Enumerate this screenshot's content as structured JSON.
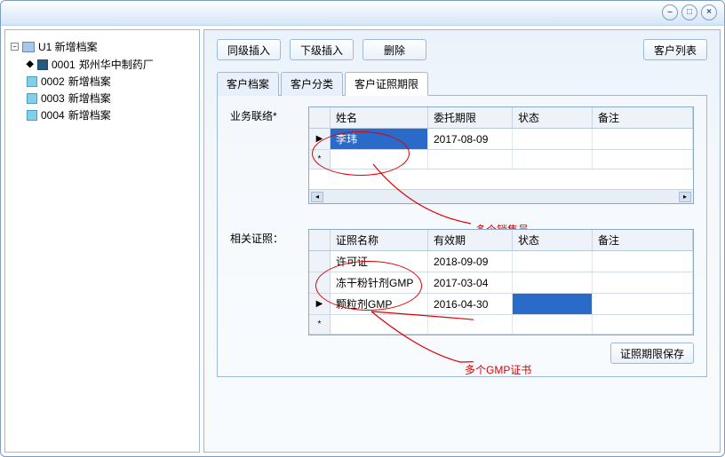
{
  "window": {
    "minimize": "–",
    "maximize": "□",
    "close": "×"
  },
  "tree": {
    "root": "U1 新增档案",
    "items": [
      {
        "code": "0001",
        "label": "郑州华中制药厂",
        "dark": true
      },
      {
        "code": "0002",
        "label": "新增档案",
        "dark": false
      },
      {
        "code": "0003",
        "label": "新增档案",
        "dark": false
      },
      {
        "code": "0004",
        "label": "新增档案",
        "dark": false
      }
    ]
  },
  "toolbar": {
    "same_level": "同级插入",
    "child_level": "下级插入",
    "delete": "删除",
    "customer_list": "客户列表"
  },
  "tabs": {
    "profile": "客户档案",
    "category": "客户分类",
    "cert_period": "客户证照期限"
  },
  "sections": {
    "contact_label": "业务联络*",
    "cert_label": "相关证照："
  },
  "contact_grid": {
    "headers": {
      "name": "姓名",
      "entrust": "委托期限",
      "status": "状态",
      "remark": "备注"
    },
    "rows": [
      {
        "name": "李玮",
        "entrust": "2017-08-09",
        "status": "",
        "remark": ""
      }
    ]
  },
  "cert_grid": {
    "headers": {
      "cert": "证照名称",
      "valid": "有效期",
      "status": "状态",
      "remark": "备注"
    },
    "rows": [
      {
        "cert": "许可证",
        "valid": "2018-09-09",
        "status": "",
        "remark": "",
        "statusSelected": false
      },
      {
        "cert": "冻干粉针剂GMP",
        "valid": "2017-03-04",
        "status": "",
        "remark": "",
        "statusSelected": false
      },
      {
        "cert": "颗粒剂GMP",
        "valid": "2016-04-30",
        "status": "",
        "remark": "",
        "statusSelected": true
      }
    ]
  },
  "annotations": {
    "multi_sales": "多个销售员",
    "multi_gmp": "多个GMP证书"
  },
  "buttons": {
    "save_cert": "证照期限保存"
  }
}
